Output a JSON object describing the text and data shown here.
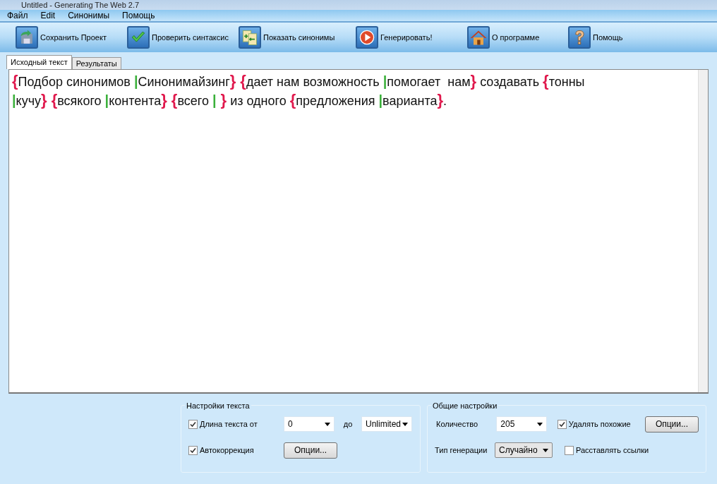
{
  "window": {
    "title": "Untitled - Generating The Web 2.7"
  },
  "menu": [
    {
      "label": "Файл"
    },
    {
      "label": "Edit"
    },
    {
      "label": "Синонимы"
    },
    {
      "label": "Помощь"
    }
  ],
  "toolbar": [
    {
      "kind": "save",
      "label": "Сохранить Проект"
    },
    {
      "kind": "check",
      "label": "Проверить синтаксис"
    },
    {
      "kind": "synonyms",
      "label": "Показать синонимы"
    },
    {
      "kind": "play",
      "label": "Генерировать!"
    },
    {
      "kind": "home",
      "label": "О программе"
    },
    {
      "kind": "help",
      "label": "Помощь"
    }
  ],
  "tabs": [
    {
      "label": "Исходный текст",
      "selected": true
    },
    {
      "label": "Результаты",
      "selected": false
    }
  ],
  "editor": {
    "lines": [
      [
        {
          "kind": "open",
          "text": "{"
        },
        {
          "kind": "text",
          "text": "Подбор синонимов "
        },
        {
          "kind": "bar",
          "text": "|"
        },
        {
          "kind": "text",
          "text": "Синонимайзинг"
        },
        {
          "kind": "close",
          "text": "}",
          "space_after": true
        },
        {
          "kind": "open",
          "text": "{"
        },
        {
          "kind": "text",
          "text": "дает нам возможность "
        },
        {
          "kind": "bar",
          "text": "|"
        },
        {
          "kind": "text",
          "text": "помогает  нам"
        },
        {
          "kind": "close",
          "text": "}"
        },
        {
          "kind": "text",
          "text": " создавать "
        },
        {
          "kind": "open",
          "text": "{"
        },
        {
          "kind": "text",
          "text": "тонны"
        }
      ],
      [
        {
          "kind": "bar",
          "text": "|"
        },
        {
          "kind": "text",
          "text": "кучу"
        },
        {
          "kind": "close",
          "text": "}",
          "space_after": true
        },
        {
          "kind": "open",
          "text": "{"
        },
        {
          "kind": "text",
          "text": "всякого "
        },
        {
          "kind": "bar",
          "text": "|"
        },
        {
          "kind": "text",
          "text": "контента"
        },
        {
          "kind": "close",
          "text": "}",
          "space_after": true
        },
        {
          "kind": "open",
          "text": "{"
        },
        {
          "kind": "text",
          "text": "всего "
        },
        {
          "kind": "bar",
          "text": "|",
          "space_after": true
        },
        {
          "kind": "close",
          "text": "}"
        },
        {
          "kind": "text",
          "text": " из одного "
        },
        {
          "kind": "open",
          "text": "{"
        },
        {
          "kind": "text",
          "text": "предложения "
        },
        {
          "kind": "bar",
          "text": "|"
        },
        {
          "kind": "text",
          "text": "варианта"
        },
        {
          "kind": "close",
          "text": "}"
        },
        {
          "kind": "text",
          "text": "."
        }
      ]
    ]
  },
  "text_settings": {
    "title": "Настройки текста",
    "length": {
      "label": "Длина текста от",
      "checked": true,
      "from": "0",
      "to_label": "до",
      "to": "Unlimited"
    },
    "autocorrect": {
      "label": "Автокоррекция",
      "checked": true,
      "button": "Опции..."
    }
  },
  "general_settings": {
    "title": "Общие настройки",
    "count": {
      "label": "Количество",
      "value": "205"
    },
    "remove_similar": {
      "label": "Удалять похожие",
      "checked": true,
      "button": "Опции..."
    },
    "generation_type": {
      "label": "Тип генерации",
      "value": "Случайно"
    },
    "place_links": {
      "label": "Расставлять ссылки",
      "checked": false
    }
  }
}
